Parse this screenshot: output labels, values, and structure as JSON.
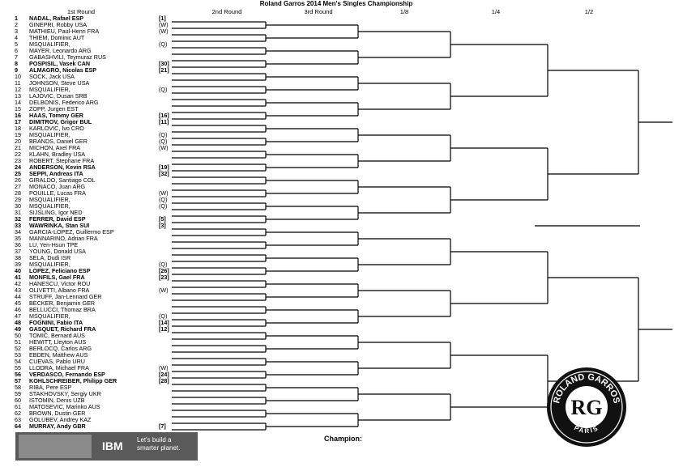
{
  "title": "Roland Garros 2014 Men's Singles Championship",
  "rounds": [
    "1st Round",
    "2nd Round",
    "3rd Round",
    "1/8",
    "1/4",
    "1/2"
  ],
  "champion_label": "Champion:",
  "banner": {
    "brand": "IBM",
    "slogan": "Let's build a smarter planet."
  },
  "logo": {
    "top": "ROLAND GARROS",
    "bottom": "PARIS",
    "mark": "RG"
  },
  "players": [
    {
      "n": "1",
      "name": "NADAL, Rafael ESP",
      "seed": "[1]",
      "bold": true
    },
    {
      "n": "2",
      "name": "GINEPRI, Robby USA",
      "seed": "(W)",
      "bold": false
    },
    {
      "n": "3",
      "name": "MATHIEU, Paul-Henri FRA",
      "seed": "(W)",
      "bold": false
    },
    {
      "n": "4",
      "name": "THIEM, Dominic AUT",
      "seed": "",
      "bold": false
    },
    {
      "n": "5",
      "name": "MSQUALIFIER,",
      "seed": "(Q)",
      "bold": false
    },
    {
      "n": "6",
      "name": "MAYER, Leonardo ARG",
      "seed": "",
      "bold": false
    },
    {
      "n": "7",
      "name": "GABASHVILI, Teymuraz RUS",
      "seed": "",
      "bold": false
    },
    {
      "n": "8",
      "name": "POSPISIL, Vasek CAN",
      "seed": "[30]",
      "bold": true
    },
    {
      "n": "9",
      "name": "ALMAGRO, Nicolas ESP",
      "seed": "[21]",
      "bold": true
    },
    {
      "n": "10",
      "name": "SOCK, Jack USA",
      "seed": "",
      "bold": false
    },
    {
      "n": "11",
      "name": "JOHNSON, Steve USA",
      "seed": "",
      "bold": false
    },
    {
      "n": "12",
      "name": "MSQUALIFIER,",
      "seed": "(Q)",
      "bold": false
    },
    {
      "n": "13",
      "name": "LAJOVIC, Dusan SRB",
      "seed": "",
      "bold": false
    },
    {
      "n": "14",
      "name": "DELBONIS, Federico ARG",
      "seed": "",
      "bold": false
    },
    {
      "n": "15",
      "name": "ZOPP, Jurgen EST",
      "seed": "",
      "bold": false
    },
    {
      "n": "16",
      "name": "HAAS, Tommy GER",
      "seed": "[16]",
      "bold": true
    },
    {
      "n": "17",
      "name": "DIMITROV, Grigor BUL",
      "seed": "[11]",
      "bold": true
    },
    {
      "n": "18",
      "name": "KARLOVIC, Ivo CRO",
      "seed": "",
      "bold": false
    },
    {
      "n": "19",
      "name": "MSQUALIFIER,",
      "seed": "(Q)",
      "bold": false
    },
    {
      "n": "20",
      "name": "BRANDS, Daniel GER",
      "seed": "(Q)",
      "bold": false
    },
    {
      "n": "21",
      "name": "MICHON, Axel FRA",
      "seed": "(W)",
      "bold": false
    },
    {
      "n": "22",
      "name": "KLAHN, Bradley USA",
      "seed": "",
      "bold": false
    },
    {
      "n": "23",
      "name": "ROBERT, Stephane FRA",
      "seed": "",
      "bold": false
    },
    {
      "n": "24",
      "name": "ANDERSON, Kevin RSA",
      "seed": "[19]",
      "bold": true
    },
    {
      "n": "25",
      "name": "SEPPI, Andreas ITA",
      "seed": "[32]",
      "bold": true
    },
    {
      "n": "26",
      "name": "GIRALDO, Santiago COL",
      "seed": "",
      "bold": false
    },
    {
      "n": "27",
      "name": "MONACO, Juan ARG",
      "seed": "",
      "bold": false
    },
    {
      "n": "28",
      "name": "POUILLE, Lucas FRA",
      "seed": "(W)",
      "bold": false
    },
    {
      "n": "29",
      "name": "MSQUALIFIER,",
      "seed": "(Q)",
      "bold": false
    },
    {
      "n": "30",
      "name": "MSQUALIFIER,",
      "seed": "(Q)",
      "bold": false
    },
    {
      "n": "31",
      "name": "SIJSLING, Igor NED",
      "seed": "",
      "bold": false
    },
    {
      "n": "32",
      "name": "FERRER, David ESP",
      "seed": "[5]",
      "bold": true
    },
    {
      "n": "33",
      "name": "WAWRINKA, Stan SUI",
      "seed": "[3]",
      "bold": true
    },
    {
      "n": "34",
      "name": "GARCIA-LOPEZ, Guillermo ESP",
      "seed": "",
      "bold": false
    },
    {
      "n": "35",
      "name": "MANNARINO, Adrian FRA",
      "seed": "",
      "bold": false
    },
    {
      "n": "36",
      "name": "LU, Yen-Hsun TPE",
      "seed": "",
      "bold": false
    },
    {
      "n": "37",
      "name": "YOUNG, Donald USA",
      "seed": "",
      "bold": false
    },
    {
      "n": "38",
      "name": "SELA, Dudi ISR",
      "seed": "",
      "bold": false
    },
    {
      "n": "39",
      "name": "MSQUALIFIER,",
      "seed": "(Q)",
      "bold": false
    },
    {
      "n": "40",
      "name": "LOPEZ, Feliciano ESP",
      "seed": "[26]",
      "bold": true
    },
    {
      "n": "41",
      "name": "MONFILS, Gael FRA",
      "seed": "[23]",
      "bold": true
    },
    {
      "n": "42",
      "name": "HANESCU, Victor ROU",
      "seed": "",
      "bold": false
    },
    {
      "n": "43",
      "name": "OLIVETTI, Albano FRA",
      "seed": "(W)",
      "bold": false
    },
    {
      "n": "44",
      "name": "STRUFF, Jan-Lennard GER",
      "seed": "",
      "bold": false
    },
    {
      "n": "45",
      "name": "BECKER, Benjamin GER",
      "seed": "",
      "bold": false
    },
    {
      "n": "46",
      "name": "BELLUCCI, Thomaz BRA",
      "seed": "",
      "bold": false
    },
    {
      "n": "47",
      "name": "MSQUALIFIER,",
      "seed": "(Q)",
      "bold": false
    },
    {
      "n": "48",
      "name": "FOGNINI, Fabio ITA",
      "seed": "[14]",
      "bold": true
    },
    {
      "n": "49",
      "name": "GASQUET, Richard FRA",
      "seed": "[12]",
      "bold": true
    },
    {
      "n": "50",
      "name": "TOMIC, Bernard AUS",
      "seed": "",
      "bold": false
    },
    {
      "n": "51",
      "name": "HEWITT, Lleyton AUS",
      "seed": "",
      "bold": false
    },
    {
      "n": "52",
      "name": "BERLOCQ, Carlos ARG",
      "seed": "",
      "bold": false
    },
    {
      "n": "53",
      "name": "EBDEN, Matthew AUS",
      "seed": "",
      "bold": false
    },
    {
      "n": "54",
      "name": "CUEVAS, Pablo URU",
      "seed": "",
      "bold": false
    },
    {
      "n": "55",
      "name": "LLODRA, Michael FRA",
      "seed": "(W)",
      "bold": false
    },
    {
      "n": "56",
      "name": "VERDASCO, Fernando ESP",
      "seed": "[24]",
      "bold": true
    },
    {
      "n": "57",
      "name": "KOHLSCHREIBER, Philipp GER",
      "seed": "[28]",
      "bold": true
    },
    {
      "n": "58",
      "name": "RIBA, Pere ESP",
      "seed": "",
      "bold": false
    },
    {
      "n": "59",
      "name": "STAKHOVSKY, Sergiy UKR",
      "seed": "",
      "bold": false
    },
    {
      "n": "60",
      "name": "ISTOMIN, Denis UZB",
      "seed": "",
      "bold": false
    },
    {
      "n": "61",
      "name": "MATOSEVIC, Marinko AUS",
      "seed": "",
      "bold": false
    },
    {
      "n": "62",
      "name": "BROWN, Dustin GER",
      "seed": "",
      "bold": false
    },
    {
      "n": "63",
      "name": "GOLUBEV, Andrey KAZ",
      "seed": "",
      "bold": false
    },
    {
      "n": "64",
      "name": "MURRAY, Andy GBR",
      "seed": "[7]",
      "bold": true
    }
  ]
}
